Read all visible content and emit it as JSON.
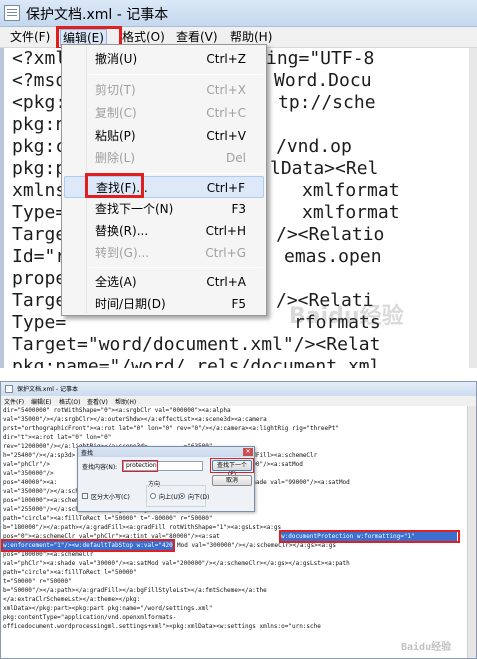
{
  "top_window": {
    "title": "保护文档.xml - 记事本",
    "menu": [
      "文件(F)",
      "编辑(E)",
      "格式(O)",
      "查看(V)",
      "帮助(H)"
    ],
    "active_menu": "编辑(E)",
    "text_left": [
      "<?xml",
      "<?mso",
      "<pkg:",
      "pkg:n",
      "pkg:c",
      "pkg:p",
      "xmlns",
      "Type=",
      "Targe",
      "Id=\"r",
      "prope",
      "Targe",
      "Type=",
      "Target=\"word/document.xml\"/><Relat",
      "pkg:name=\"/word/_rels/document.xml.",
      "pkg:contentType=\"application/vnd.op"
    ],
    "text_right": [
      "ing=\"UTF-8",
      "Word.Docu",
      "tp://sche",
      "",
      "/vnd.op",
      "lData><Rel",
      "xmlformat",
      "xmlformat",
      "/><Relatio",
      "emas.open",
      "",
      "/><Relati",
      "rformats"
    ],
    "edit_menu": [
      {
        "label": "撤消(U)",
        "shortcut": "Ctrl+Z",
        "disabled": false
      },
      {
        "label": "剪切(T)",
        "shortcut": "Ctrl+X",
        "disabled": true
      },
      {
        "label": "复制(C)",
        "shortcut": "Ctrl+C",
        "disabled": true
      },
      {
        "label": "粘贴(P)",
        "shortcut": "Ctrl+V",
        "disabled": false
      },
      {
        "label": "删除(L)",
        "shortcut": "Del",
        "disabled": true
      },
      {
        "label": "查找(F)...",
        "shortcut": "Ctrl+F",
        "disabled": false
      },
      {
        "label": "查找下一个(N)",
        "shortcut": "F3",
        "disabled": false
      },
      {
        "label": "替换(R)...",
        "shortcut": "Ctrl+H",
        "disabled": false
      },
      {
        "label": "转到(G)...",
        "shortcut": "Ctrl+G",
        "disabled": true
      },
      {
        "label": "全选(A)",
        "shortcut": "Ctrl+A",
        "disabled": false
      },
      {
        "label": "时间/日期(D)",
        "shortcut": "F5",
        "disabled": false
      }
    ],
    "highlight_color": "#e02020"
  },
  "bottom_window": {
    "title": "保护文档.xml - 记事本",
    "menu": [
      "文件(F)",
      "编辑(E)",
      "格式(O)",
      "查看(V)",
      "帮助(H)"
    ],
    "lines": [
      "dir=\"5400000\" rotWithShape=\"0\"><a:srgbClr val=\"000000\"><a:alpha",
      "val=\"35000\"/></a:srgbClr></a:outerShdw></a:effectLst><a:scene3d><a:camera",
      "prst=\"orthographicFront\"><a:rot lat=\"0\" lon=\"0\" rev=\"0\"/></a:camera><a:lightRig rig=\"threePt\"",
      "dir=\"t\"><a:rot lat=\"0\" lon=\"0\"",
      "rev=\"1200000\"/></a:lightRig></a:scene3d>          =\"63500\"",
      "h=\"25400\"/></a:sp3d>                    Lst><a:bgFillStyleLst><a:solidFill><a:schemeClr",
      "val=\"phClr\"/>                            val=\"phClr\"><a:tint val=\"40000\"/><a:satMod",
      "val=\"350000\"/>                           ",
      "pos=\"40000\"><a:                          r\"><a:tint val=\"45000\"/><a:shade val=\"99000\"/><a:satMod",
      "val=\"350000\"/></a:schemeClr></a:gs>",
      "pos=\"100000\"><a:schemeClr val=\"phClr\"><a:shade val=\"20000\"/><a:satMod",
      "val=\"255000\"/></a:schemeClr></a:gs></a:gsLst><a:path",
      "path=\"circle\"><a:fillToRect l=\"50000\" t=\"-80000\" r=\"50000\"",
      "b=\"180000\"/></a:path></a:gradFill><a:gradFill rotWithShape=\"1\"><a:gsLst><a:gs",
      "pos=\"0\"><a:schemeClr val=\"phClr\"><a:tint val=\"80000\"/><a:sat",
      "",
      "pos=\"100000\"><a:schemeClr",
      "val=\"phClr\"><a:shade val=\"30000\"/><a:satMod val=\"200000\"/></a:schemeClr></a:gs></a:gsLst><a:path",
      "path=\"circle\"><a:fillToRect l=\"50000\"",
      "t=\"50000\" r=\"50000\"",
      "b=\"50000\"/></a:path></a:gradFill></a:bgFillStyleLst></a:fmtScheme></a:the",
      "</a:extraClrSchemeLst></a:theme></pkg:",
      "xmlData></pkg:part><pkg:part pkg:name=\"/word/settings.xml\"",
      "pkg:contentType=\"application/vnd.openxmlformats-",
      "officedocument.wordprocessingml.settings+xml\"><pkg:xmlData><w:settings xmlns:o=\"urn:sche"
    ],
    "selection_1": "w:documentProtection w:formatting=\"1\"",
    "selection_2": "w:enforcement=\"1\"/><w:defaultTabStop w:val=\"420\"/>",
    "line15_tail": "Mod val=\"300000\"/></a:schemeClr></a:gs><a:gs",
    "find_dialog": {
      "title": "查找",
      "find_label": "查找内容(N):",
      "find_value": "protection",
      "find_next_button": "查找下一个(F)",
      "cancel_button": "取消",
      "direction_label": "方向",
      "up_label": "向上(U)",
      "down_label": "向下(D)",
      "match_case_label": "区分大小写(C)"
    }
  },
  "watermark": "Baidu经验"
}
